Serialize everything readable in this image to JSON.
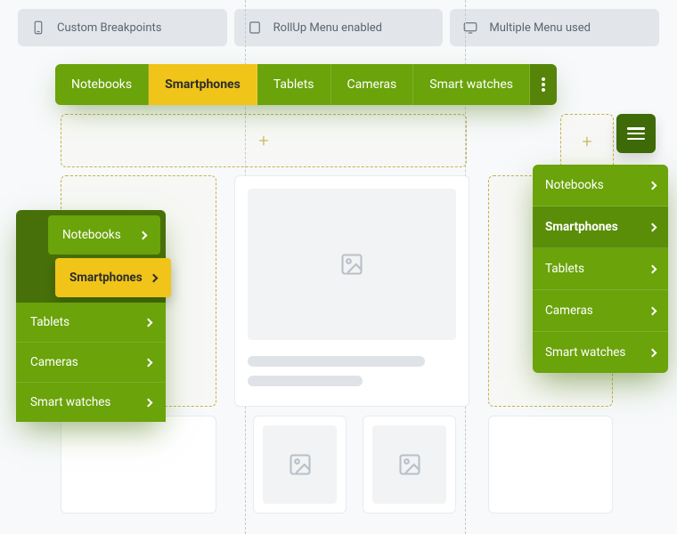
{
  "topbar": {
    "chip1": "Custom Breakpoints",
    "chip2": "RollUp Menu enabled",
    "chip3": "Multiple Menu used"
  },
  "tabs": {
    "items": [
      "Notebooks",
      "Smartphones",
      "Tablets",
      "Cameras",
      "Smart watches"
    ],
    "active_index": 1
  },
  "left_menu": {
    "pop1": "Notebooks",
    "pop2": "Smartphones",
    "rest": [
      "Tablets",
      "Cameras",
      "Smart watches"
    ]
  },
  "right_menu": {
    "items": [
      "Notebooks",
      "Smartphones",
      "Tablets",
      "Cameras",
      "Smart watches"
    ],
    "active_index": 1
  },
  "colors": {
    "green": "#6aa30a",
    "green_dark": "#47700a",
    "yellow": "#f0c419"
  }
}
